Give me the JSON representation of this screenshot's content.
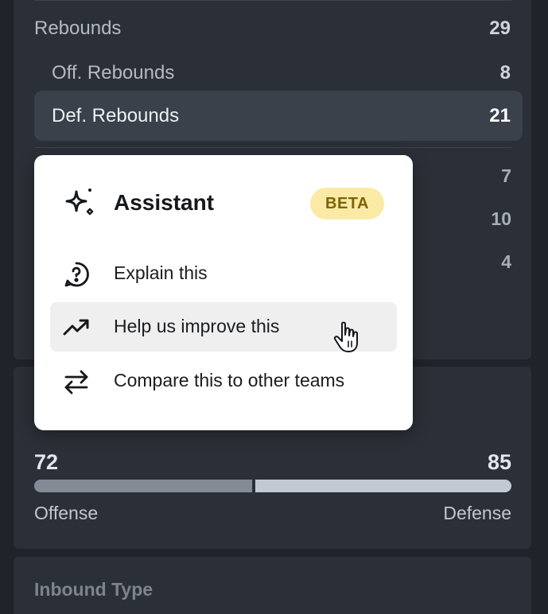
{
  "stats": {
    "rebounds": {
      "label": "Rebounds",
      "value": "29"
    },
    "off_rebounds": {
      "label": "Off. Rebounds",
      "value": "8"
    },
    "def_rebounds": {
      "label": "Def. Rebounds",
      "value": "21"
    },
    "partially_hidden_values": [
      "7",
      "10",
      "4"
    ]
  },
  "comparison": {
    "offense_value": "72",
    "defense_value": "85",
    "offense_label": "Offense",
    "defense_label": "Defense",
    "offense_share": 0.459
  },
  "next_section": {
    "title": "Inbound Type"
  },
  "menu": {
    "title": "Assistant",
    "badge": "BETA",
    "items": [
      {
        "label": "Explain this",
        "icon": "chat-question-icon"
      },
      {
        "label": "Help us improve this",
        "icon": "trending-up-icon",
        "hovered": true
      },
      {
        "label": "Compare this to other teams",
        "icon": "swap-arrows-icon"
      }
    ]
  },
  "colors": {
    "background": "#1f232a",
    "panel": "#2b3038",
    "highlight_row": "#3a414b",
    "badge_bg": "#fbeaa6",
    "badge_text": "#7f6206",
    "offense_bar": "#858b96",
    "defense_bar": "#c3c9d3"
  }
}
